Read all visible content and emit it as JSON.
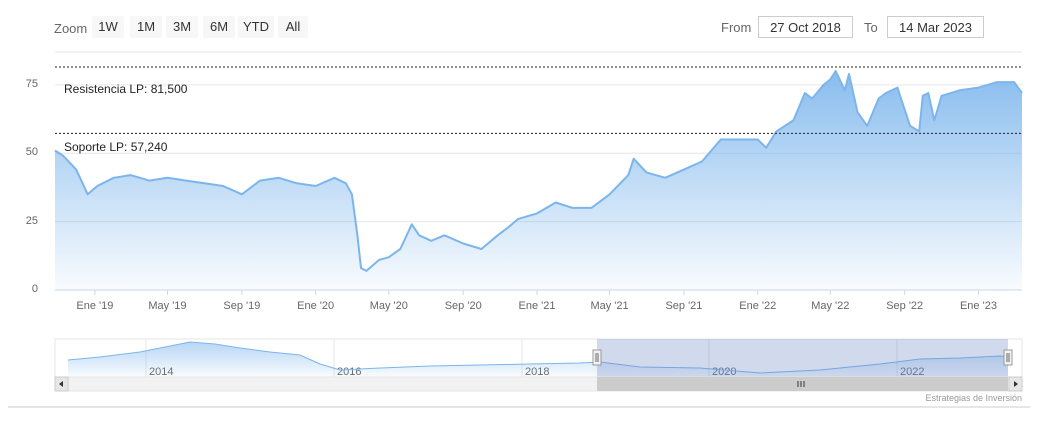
{
  "range_selector": {
    "zoom_label": "Zoom",
    "buttons": [
      "1W",
      "1M",
      "3M",
      "6M",
      "YTD",
      "All"
    ],
    "from_label": "From",
    "from_value": "27 Oct 2018",
    "to_label": "To",
    "to_value": "14 Mar 2023"
  },
  "credits": "Estrategias de Inversión",
  "colors": {
    "series_line": "#7cb5ec",
    "area_top": "#7cb5ec",
    "plot_line": "#222222",
    "navigator_mask": "rgba(102,133,194,0.3)"
  },
  "chart_data": {
    "type": "area",
    "title": "",
    "xlabel": "",
    "ylabel": "",
    "ylim": [
      0,
      87
    ],
    "yticks": [
      0,
      25,
      50,
      75
    ],
    "xlim": [
      "2018-10-27",
      "2023-03-14"
    ],
    "xticks": [
      "Ene '19",
      "May '19",
      "Sep '19",
      "Ene '20",
      "May '20",
      "Sep '20",
      "Ene '21",
      "May '21",
      "Sep '21",
      "Ene '22",
      "May '22",
      "Sep '22",
      "Ene '23"
    ],
    "grid": true,
    "legend": "none",
    "plot_lines": [
      {
        "label": "Resistencia LP: 81,500",
        "value": 81.5
      },
      {
        "label": "Soporte LP: 57,240",
        "value": 57.24
      }
    ],
    "series": [
      {
        "x": [
          "2018-10-27",
          "2018-11-10",
          "2018-12-01",
          "2018-12-20",
          "2019-01-05",
          "2019-02-01",
          "2019-03-01",
          "2019-04-01",
          "2019-05-01",
          "2019-06-01",
          "2019-07-01",
          "2019-08-01",
          "2019-09-01",
          "2019-10-01",
          "2019-11-01",
          "2019-12-01",
          "2020-01-01",
          "2020-02-01",
          "2020-02-20",
          "2020-03-01",
          "2020-03-10",
          "2020-03-16",
          "2020-03-25",
          "2020-04-15",
          "2020-05-01",
          "2020-05-20",
          "2020-06-08",
          "2020-06-20",
          "2020-07-10",
          "2020-08-01",
          "2020-09-01",
          "2020-10-01",
          "2020-10-28",
          "2020-11-15",
          "2020-12-01",
          "2021-01-01",
          "2021-02-01",
          "2021-03-01",
          "2021-04-01",
          "2021-05-01",
          "2021-06-01",
          "2021-06-10",
          "2021-07-01",
          "2021-08-01",
          "2021-09-01",
          "2021-10-01",
          "2021-11-01",
          "2021-12-01",
          "2022-01-01",
          "2022-01-15",
          "2022-02-01",
          "2022-03-01",
          "2022-03-20",
          "2022-04-01",
          "2022-04-20",
          "2022-05-01",
          "2022-05-10",
          "2022-05-25",
          "2022-06-01",
          "2022-06-15",
          "2022-07-01",
          "2022-07-20",
          "2022-08-01",
          "2022-08-20",
          "2022-09-10",
          "2022-09-25",
          "2022-10-01",
          "2022-10-10",
          "2022-10-20",
          "2022-11-01",
          "2022-12-01",
          "2023-01-01",
          "2023-02-01",
          "2023-03-01",
          "2023-03-14"
        ],
        "y": [
          51,
          49,
          44,
          35,
          38,
          41,
          42,
          40,
          41,
          40,
          39,
          38,
          35,
          40,
          41,
          39,
          38,
          41,
          39,
          35,
          20,
          8,
          7,
          11,
          12,
          15,
          24,
          20,
          18,
          20,
          17,
          15,
          20,
          23,
          26,
          28,
          32,
          30,
          30,
          35,
          42,
          48,
          43,
          41,
          44,
          47,
          55,
          55,
          55,
          52,
          58,
          62,
          72,
          70,
          75,
          77,
          80,
          73,
          79,
          65,
          60,
          70,
          72,
          74,
          60,
          58,
          71,
          72,
          62,
          71,
          73,
          74,
          76,
          76,
          72
        ]
      }
    ]
  },
  "navigator": {
    "year_labels": [
      "2014",
      "2016",
      "2018",
      "2020",
      "2022"
    ]
  }
}
